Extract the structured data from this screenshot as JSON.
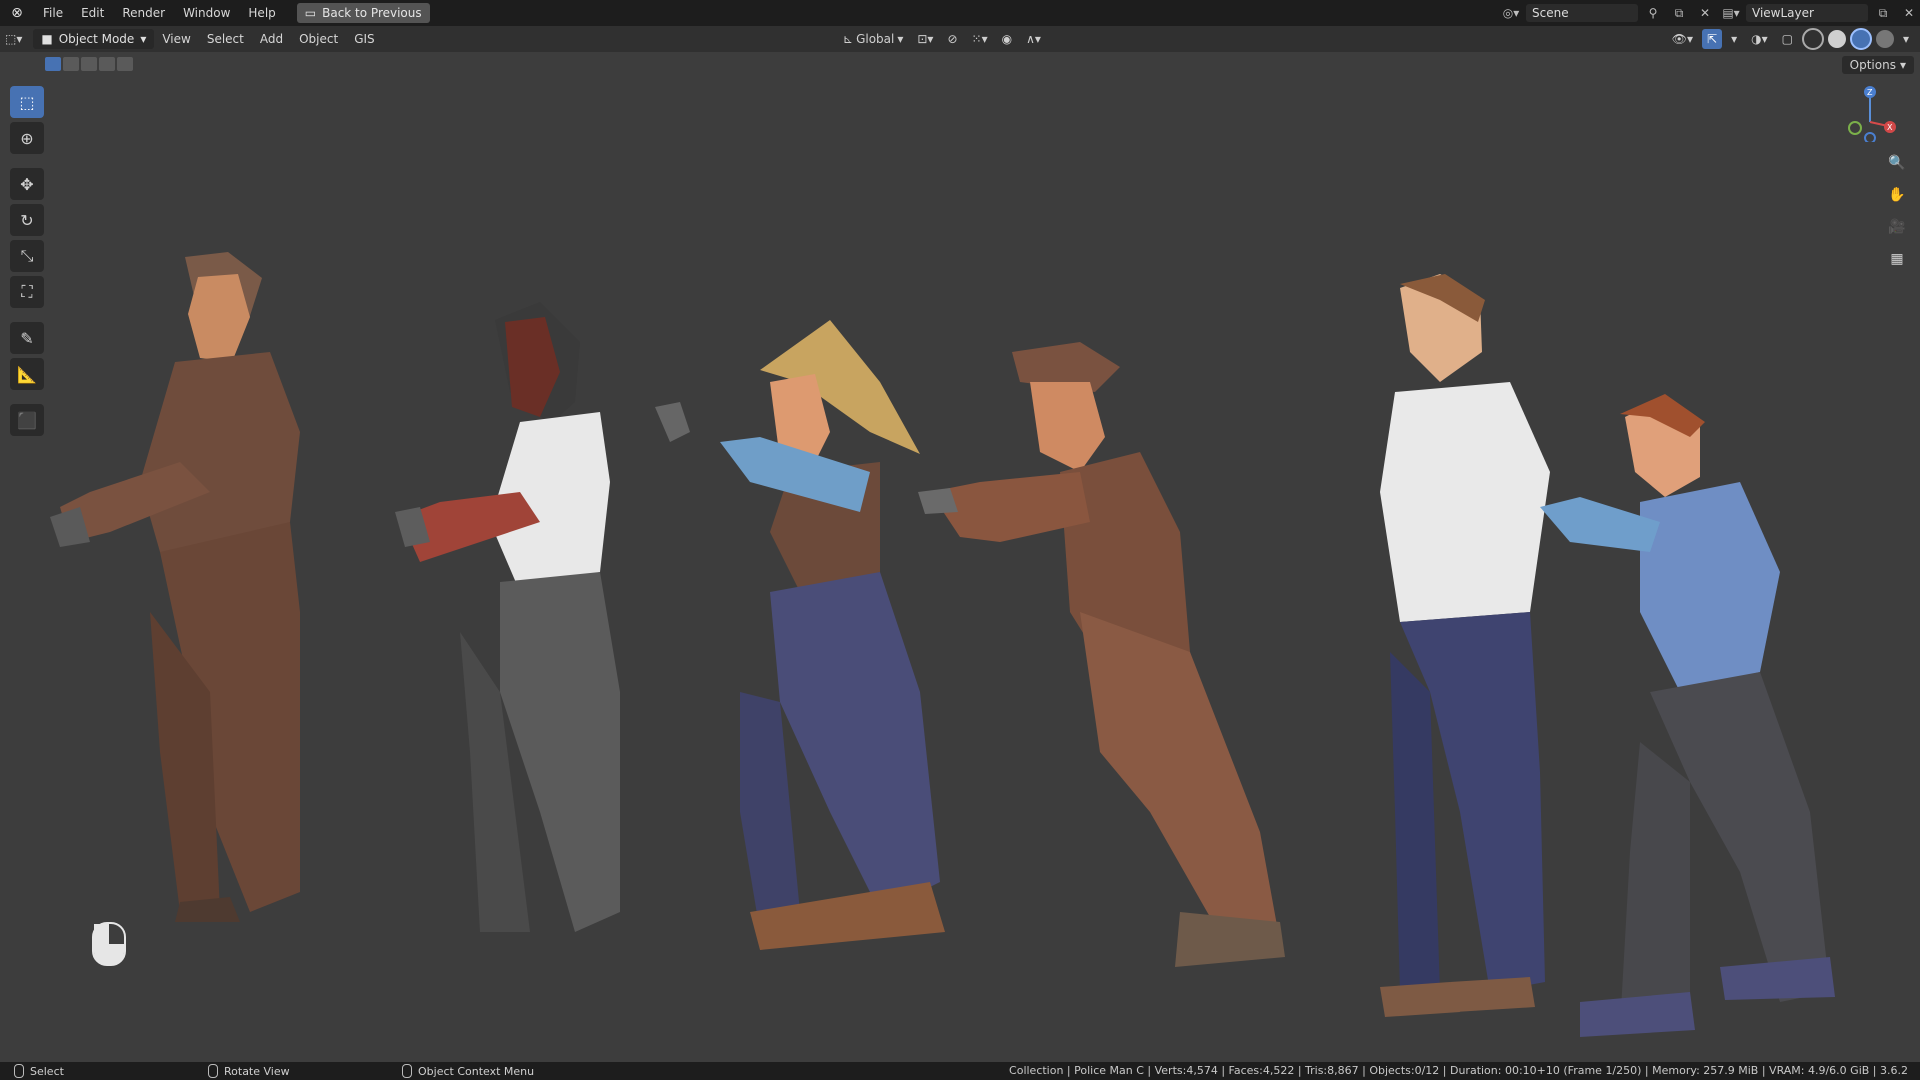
{
  "topbar": {
    "menus": [
      "File",
      "Edit",
      "Render",
      "Window",
      "Help"
    ],
    "back_label": "Back to Previous",
    "scene": "Scene",
    "view_layer": "ViewLayer"
  },
  "header": {
    "mode": "Object Mode",
    "menus": [
      "View",
      "Select",
      "Add",
      "Object",
      "GIS"
    ],
    "orientation": "Global",
    "options": "Options"
  },
  "status": {
    "left": [
      {
        "label": "Select"
      },
      {
        "label": "Rotate View"
      },
      {
        "label": "Object Context Menu"
      }
    ],
    "stats": "Collection | Police Man C | Verts:4,574 | Faces:4,522 | Tris:8,867 | Objects:0/12 | Duration: 00:10+10 (Frame 1/250) | Memory: 257.9 MiB | VRAM: 4.9/6.0 GiB | 3.6.2"
  },
  "colors": {
    "accent": "#4772b3",
    "viewport_bg": "#3d3d3d",
    "topbar_bg": "#1d1d1d",
    "header_bg": "#303030"
  },
  "icons": {
    "tools": [
      "select-box-icon",
      "cursor-icon",
      "move-icon",
      "rotate-icon",
      "scale-icon",
      "transform-icon",
      "annotate-icon",
      "measure-icon",
      "add-cube-icon"
    ],
    "nav": [
      "zoom-icon",
      "pan-hand-icon",
      "camera-icon",
      "grid-icon"
    ]
  }
}
